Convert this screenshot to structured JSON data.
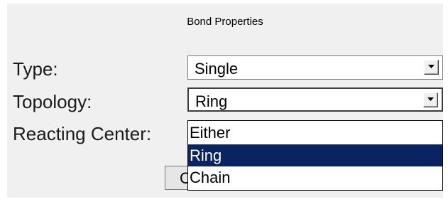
{
  "dialog": {
    "title": "Bond Properties"
  },
  "fields": {
    "type": {
      "label": "Type:",
      "value": "Single"
    },
    "topology": {
      "label": "Topology:",
      "value": "Ring"
    },
    "reacting_center": {
      "label": "Reacting Center:"
    }
  },
  "dropdown": {
    "options": [
      "Either",
      "Ring",
      "Chain"
    ],
    "selected": "Ring"
  },
  "buttons": {
    "ok_partial": "C"
  },
  "icons": {
    "combo_arrow": "chevron-down-icon"
  },
  "colors": {
    "selection": "#0a2463",
    "dialog_bg": "#f0f0f0"
  }
}
